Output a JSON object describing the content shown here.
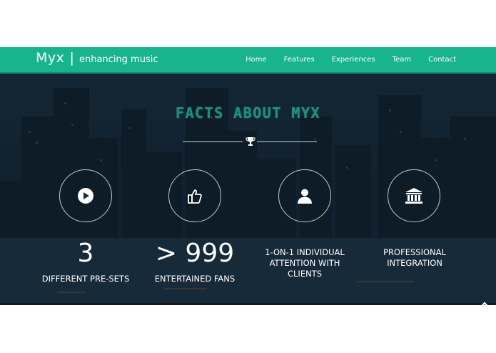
{
  "brand": {
    "name": "Myx",
    "separator": "|",
    "tagline": "enhancing music"
  },
  "nav": {
    "items": [
      {
        "label": "Home"
      },
      {
        "label": "Features"
      },
      {
        "label": "Experiences"
      },
      {
        "label": "Team"
      },
      {
        "label": "Contact"
      }
    ]
  },
  "colors": {
    "navbar": "#17b48e",
    "title": "#1d8f7a",
    "hero_bg": "#1b2b38"
  },
  "section": {
    "title": "FACTS ABOUT MYX",
    "divider_icon": "trophy-icon",
    "facts": [
      {
        "icon": "play-icon",
        "value": "3",
        "label": "DIFFERENT PRE-SETS"
      },
      {
        "icon": "thumbs-up-icon",
        "value": "> 999",
        "label": "ENTERTAINED FANS"
      },
      {
        "icon": "user-icon",
        "value": "",
        "label": "1-ON-1 INDIVIDUAL ATTENTION WITH CLIENTS"
      },
      {
        "icon": "institution-icon",
        "value": "",
        "label": "PROFESSIONAL INTEGRATION"
      }
    ]
  },
  "scroll_top_icon": "chevron-up-icon"
}
